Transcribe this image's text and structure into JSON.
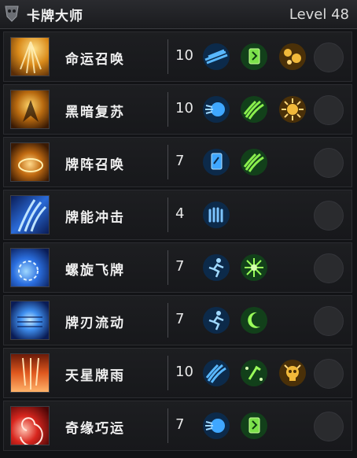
{
  "header": {
    "title": "卡牌大师",
    "level": "Level 48",
    "emblem_icon": "mask-icon"
  },
  "skills": [
    {
      "name": "命运召唤",
      "points": "10",
      "icon": "golden-rays-skill-icon",
      "augments": [
        "blue-slash-icon",
        "green-card-icon",
        "gold-orbs-icon"
      ]
    },
    {
      "name": "黑暗复苏",
      "points": "10",
      "icon": "dark-demon-skill-icon",
      "augments": [
        "blue-orb-icon",
        "green-claw-icon",
        "gold-sun-icon"
      ]
    },
    {
      "name": "牌阵召唤",
      "points": "7",
      "icon": "gold-circle-skill-icon",
      "augments": [
        "blue-card-icon",
        "green-claw-icon"
      ]
    },
    {
      "name": "牌能冲击",
      "points": "4",
      "icon": "blue-wave-skill-icon",
      "augments": [
        "blue-claw-icon"
      ]
    },
    {
      "name": "螺旋飞牌",
      "points": "7",
      "icon": "blue-spiral-skill-icon",
      "augments": [
        "blue-runner-icon",
        "green-burst-icon"
      ]
    },
    {
      "name": "牌刃流动",
      "points": "7",
      "icon": "blue-stream-skill-icon",
      "augments": [
        "blue-runner-icon",
        "green-moon-icon"
      ]
    },
    {
      "name": "天星牌雨",
      "points": "10",
      "icon": "red-rain-skill-icon",
      "augments": [
        "blue-slash-icon",
        "green-sparkle-icon",
        "gold-skull-icon"
      ]
    },
    {
      "name": "奇缘巧运",
      "points": "7",
      "icon": "red-spiral-skill-icon",
      "augments": [
        "blue-orb-icon",
        "green-card-icon"
      ]
    }
  ]
}
